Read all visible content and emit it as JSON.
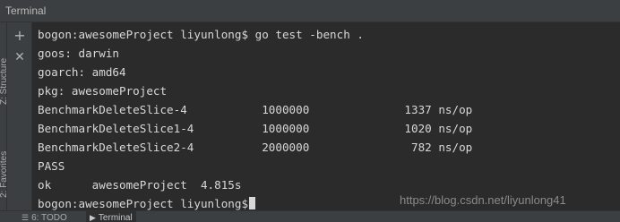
{
  "window": {
    "title": "Terminal"
  },
  "toolbar": {
    "new_session_icon": "plus-icon",
    "close_session_icon": "close-icon"
  },
  "side_panels": {
    "structure_label": "Z: Structure",
    "favorites_label": "2: Favorites"
  },
  "terminal": {
    "lines": [
      "bogon:awesomeProject liyunlong$ go test -bench .",
      "goos: darwin",
      "goarch: amd64",
      "pkg: awesomeProject",
      "BenchmarkDeleteSlice-4           1000000              1337 ns/op",
      "BenchmarkDeleteSlice1-4          1000000              1020 ns/op",
      "BenchmarkDeleteSlice2-4          2000000               782 ns/op",
      "PASS",
      "ok      awesomeProject  4.815s",
      "bogon:awesomeProject liyunlong$"
    ]
  },
  "watermark": "https://blog.csdn.net/liyunlong41",
  "bottom_tabs": [
    {
      "label": "6: TODO",
      "icon": "todo-icon"
    },
    {
      "label": "Terminal",
      "icon": "terminal-icon",
      "active": true
    }
  ]
}
